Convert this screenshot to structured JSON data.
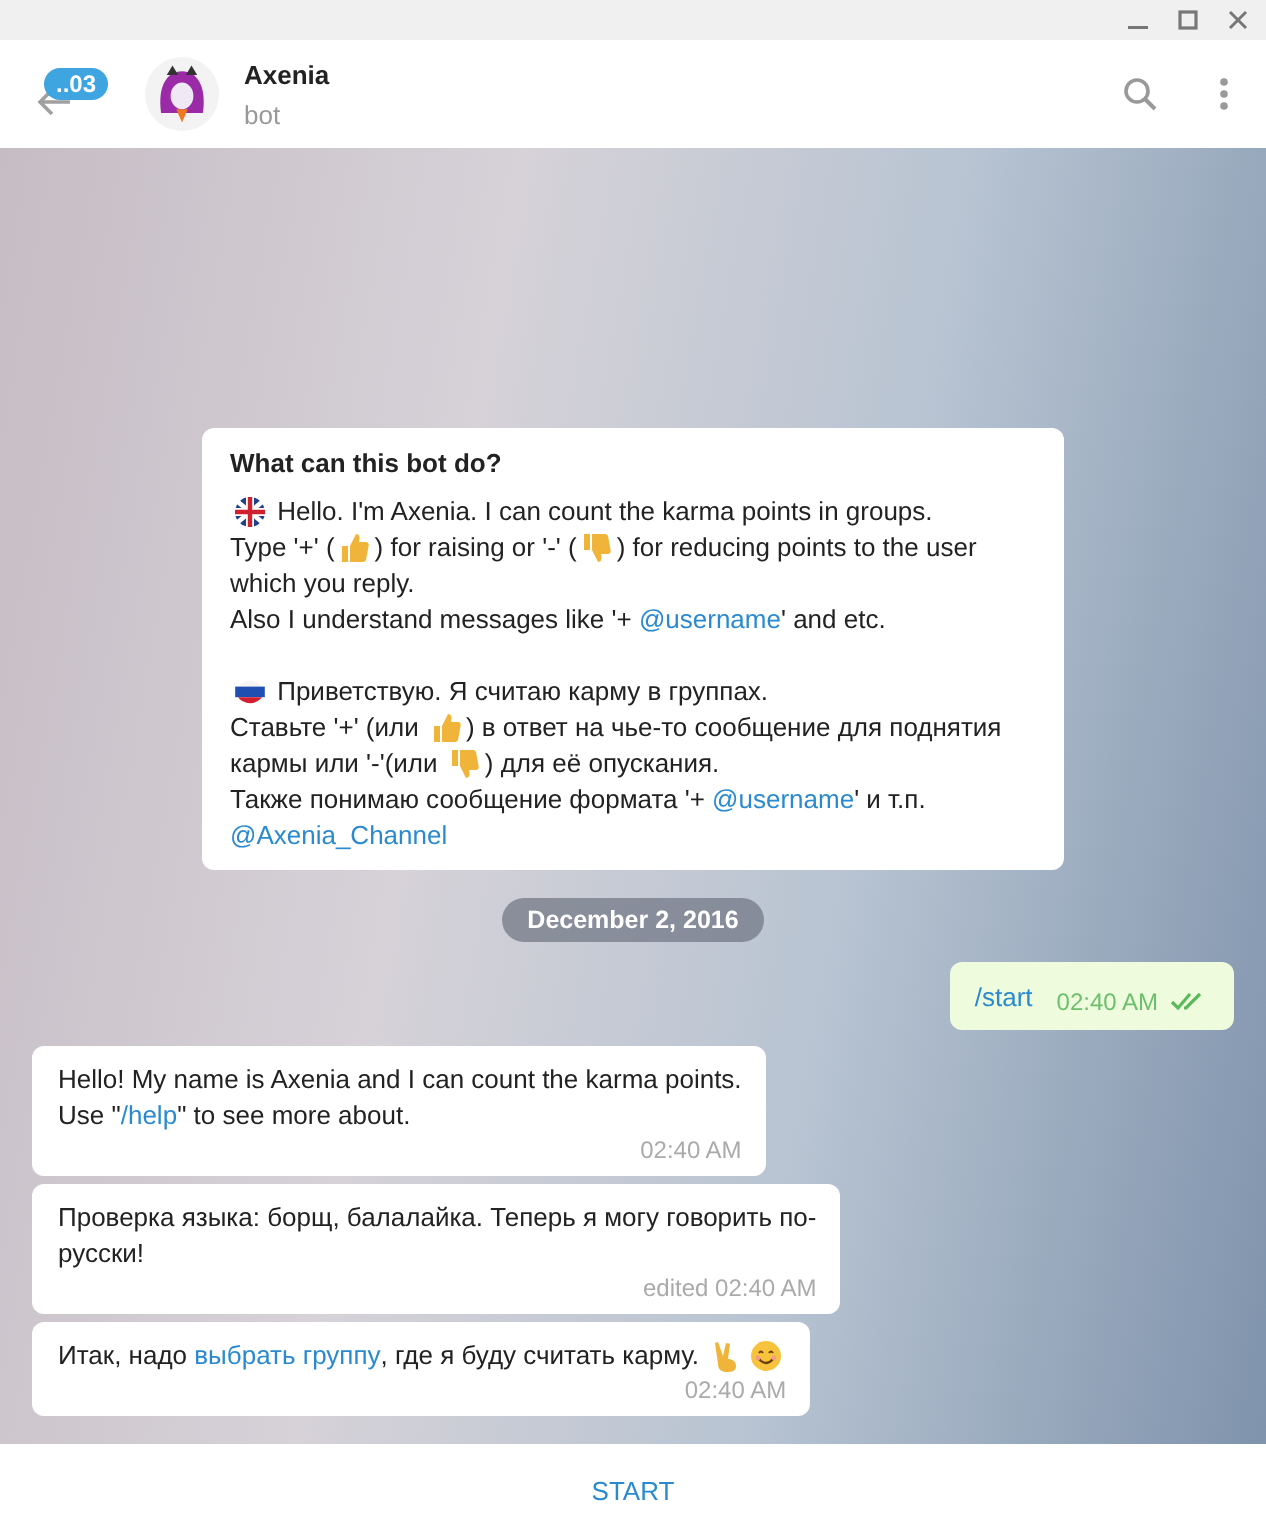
{
  "header": {
    "unread_badge": "..03",
    "name": "Axenia",
    "status": "bot"
  },
  "info_card": {
    "title": "What can this bot do?",
    "paragraphs": [
      [
        [
          {
            "kind": "flag-uk"
          },
          {
            "kind": "text",
            "text": " Hello. I'm Axenia. I can count the karma points in groups."
          }
        ],
        [
          {
            "kind": "text",
            "text": "Type '+' ("
          },
          {
            "kind": "thumbs-up"
          },
          {
            "kind": "text",
            "text": ") for raising or '-' ("
          },
          {
            "kind": "thumbs-down"
          },
          {
            "kind": "text",
            "text": ") for reducing points to the user"
          }
        ],
        [
          {
            "kind": "text",
            "text": "which you reply."
          }
        ],
        [
          {
            "kind": "text",
            "text": "Also I understand messages like '+ "
          },
          {
            "kind": "link",
            "text": "@username"
          },
          {
            "kind": "text",
            "text": "' and etc."
          }
        ]
      ],
      [
        [
          {
            "kind": "flag-ru"
          },
          {
            "kind": "text",
            "text": " Приветствую. Я считаю карму в группах."
          }
        ],
        [
          {
            "kind": "text",
            "text": "Ставьте '+' (или "
          },
          {
            "kind": "thumbs-up"
          },
          {
            "kind": "text",
            "text": ") в ответ на чье-то сообщение для поднятия"
          }
        ],
        [
          {
            "kind": "text",
            "text": "кармы или '-'(или "
          },
          {
            "kind": "thumbs-down"
          },
          {
            "kind": "text",
            "text": ") для её опускания."
          }
        ],
        [
          {
            "kind": "text",
            "text": "Также понимаю сообщение формата '+ "
          },
          {
            "kind": "link",
            "text": "@username"
          },
          {
            "kind": "text",
            "text": "' и т.п."
          }
        ],
        [
          {
            "kind": "link",
            "text": "@Axenia_Channel"
          }
        ]
      ]
    ]
  },
  "date_divider": "December 2, 2016",
  "messages": [
    {
      "kind": "outgoing",
      "read": true,
      "time": "02:40 AM",
      "lines": [
        [
          {
            "kind": "link",
            "text": "/start"
          }
        ]
      ]
    },
    {
      "kind": "incoming",
      "time": "02:40 AM",
      "lines": [
        [
          {
            "kind": "text",
            "text": "Hello! My name is Axenia and I can count the karma points."
          }
        ],
        [
          {
            "kind": "text",
            "text": "Use \""
          },
          {
            "kind": "link",
            "text": "/help"
          },
          {
            "kind": "text",
            "text": "\" to see more about."
          }
        ]
      ]
    },
    {
      "kind": "incoming",
      "time": "edited 02:40 AM",
      "lines": [
        [
          {
            "kind": "text",
            "text": "Проверка языка: борщ, балалайка. Теперь я могу говорить по-"
          }
        ],
        [
          {
            "kind": "text",
            "text": "русски!"
          }
        ]
      ]
    },
    {
      "kind": "incoming",
      "time": "02:40 AM",
      "lines": [
        [
          {
            "kind": "text",
            "text": "Итак, надо "
          },
          {
            "kind": "link",
            "text": "выбрать группу"
          },
          {
            "kind": "text",
            "text": ", где я буду считать карму. "
          },
          {
            "kind": "victory"
          },
          {
            "kind": "smile"
          }
        ]
      ]
    }
  ],
  "start_button": "START"
}
